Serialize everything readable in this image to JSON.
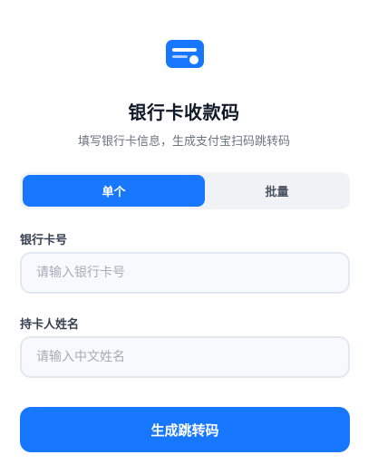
{
  "header": {
    "icon": "card-icon",
    "title": "银行卡收款码",
    "subtitle": "填写银行卡信息，生成支付宝扫码跳转码"
  },
  "mode_tabs": {
    "single_label": "单个",
    "batch_label": "批量",
    "selected": "单个"
  },
  "form": {
    "card_number": {
      "label": "银行卡号",
      "placeholder": "请输入银行卡号",
      "value": ""
    },
    "holder_name": {
      "label": "持卡人姓名",
      "placeholder": "请输入中文姓名",
      "value": ""
    },
    "submit_label": "生成跳转码"
  },
  "colors": {
    "accent": "#1877ff",
    "tab_background": "#f0f2f5",
    "input_background": "#f8f9fc",
    "input_border": "#e3e7ef"
  }
}
